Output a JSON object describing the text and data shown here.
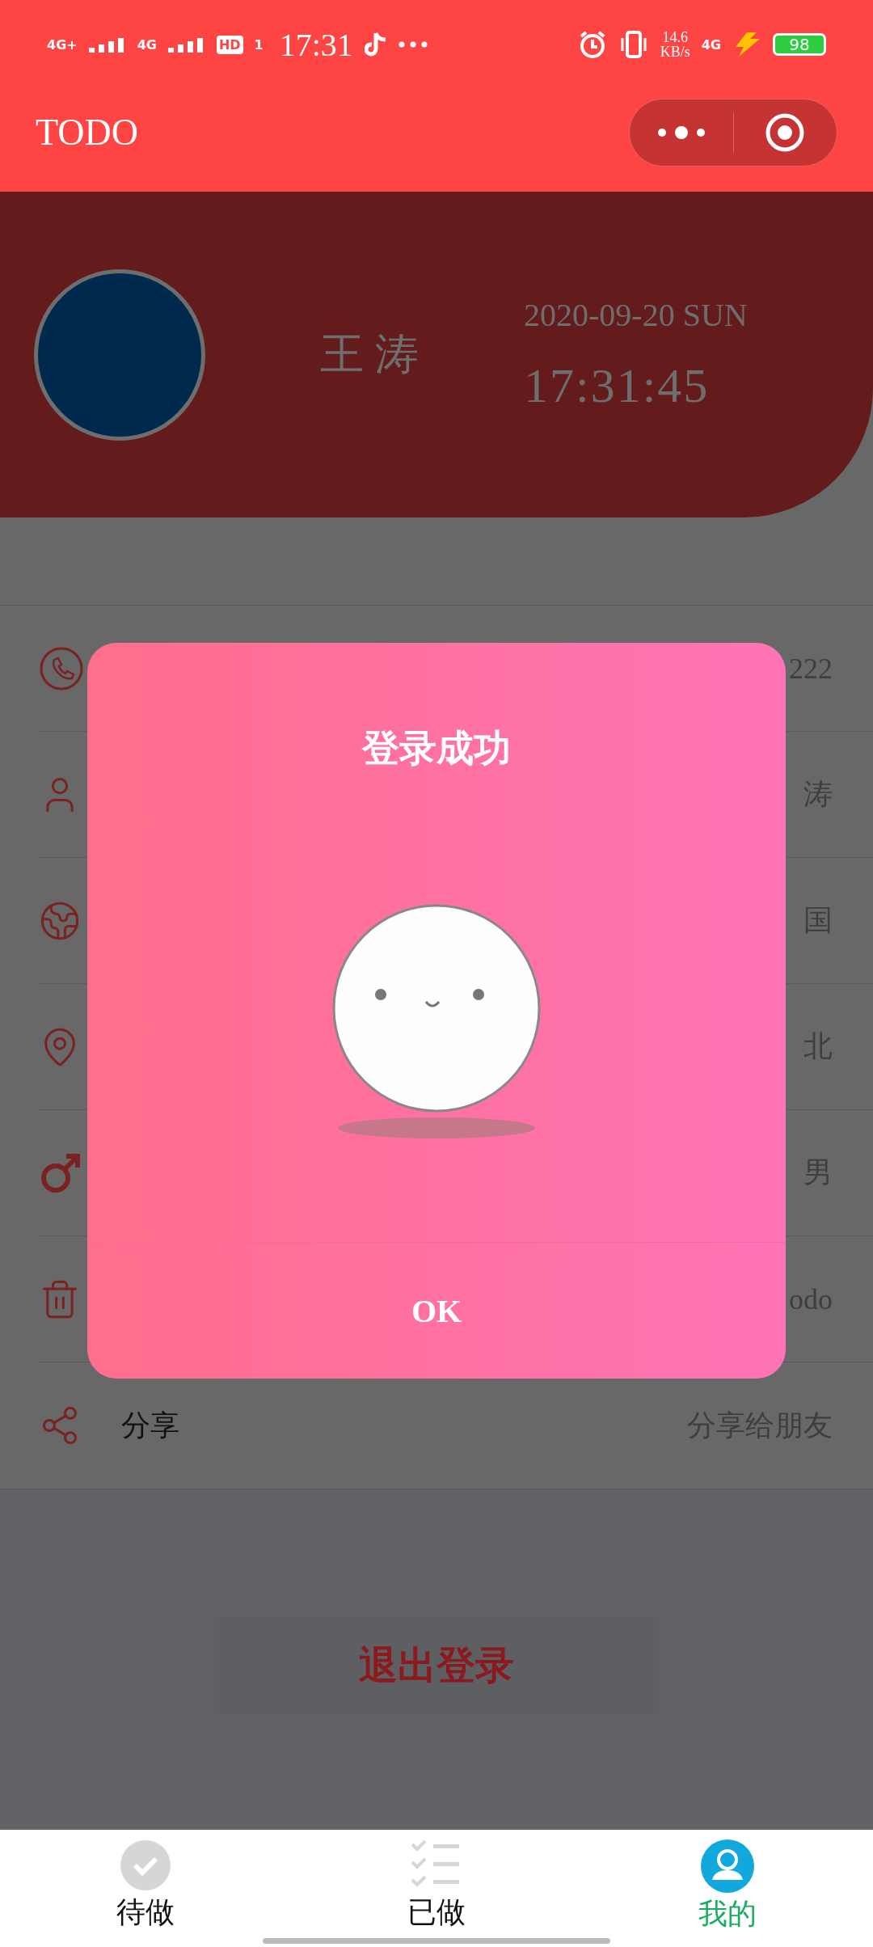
{
  "status_bar": {
    "left_signal": "4G+",
    "right_signal": "4G",
    "hd": "HD",
    "sim": "1",
    "time": "17:31",
    "speed": "14.6",
    "speed_unit": "KB/s",
    "data_label": "4G",
    "battery": "98"
  },
  "title_bar": {
    "title": "TODO"
  },
  "profile": {
    "name": "王 涛",
    "date": "2020-09-20 SUN",
    "time": "17:31:45"
  },
  "rows": [
    {
      "kind": "phone",
      "value": "222"
    },
    {
      "kind": "user",
      "value": "涛"
    },
    {
      "kind": "globe",
      "value": "国"
    },
    {
      "kind": "location",
      "value": "北"
    },
    {
      "kind": "male",
      "value": "男"
    },
    {
      "kind": "trash",
      "value": "odo"
    },
    {
      "kind": "share",
      "label": "分享",
      "value": "分享给朋友"
    }
  ],
  "logout_button": {
    "label": "退出登录"
  },
  "dialog": {
    "title": "登录成功",
    "button": "OK"
  },
  "tabs": [
    {
      "kind": "todo",
      "label": "待做",
      "selected": false
    },
    {
      "kind": "done",
      "label": "已做",
      "selected": false
    },
    {
      "kind": "mine",
      "label": "我的",
      "selected": true
    }
  ]
}
